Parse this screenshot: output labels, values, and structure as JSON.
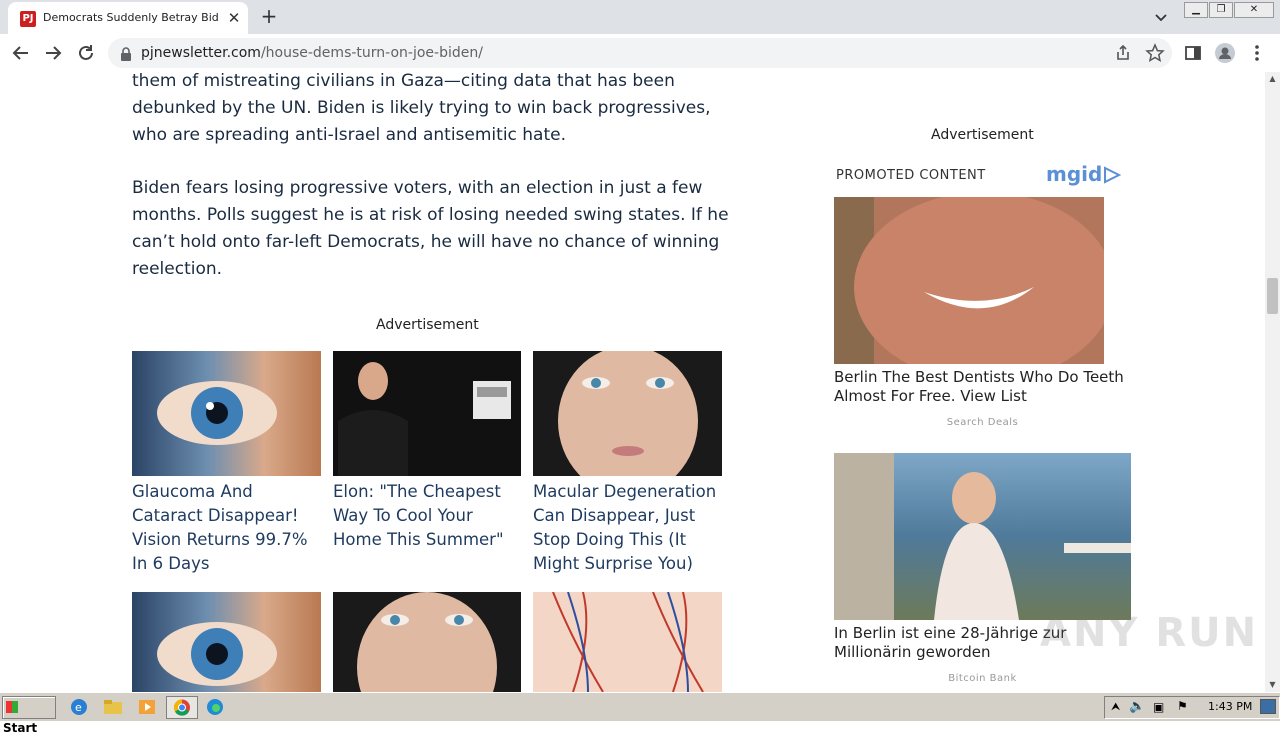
{
  "browser": {
    "tab_title": "Democrats Suddenly Betray Biden o",
    "tab_favicon_text": "PJ",
    "new_tab_label": "+",
    "url_domain": "pjnewsletter.com",
    "url_path": "/house-dems-turn-on-joe-biden/"
  },
  "article": {
    "paragraph1": "them of mistreating civilians in Gaza—citing data that has been debunked by the UN. Biden is likely trying to win back progressives, who are spreading anti-Israel and antisemitic hate.",
    "paragraph2": "Biden fears losing progressive voters, with an election in just a few months. Polls suggest he is at risk of losing needed swing states. If he can’t hold onto far-left Democrats, he will have no chance of winning reelection."
  },
  "inline_ads": {
    "label": "Advertisement",
    "cards": [
      {
        "title": "Glaucoma And Cataract Disappear! Vision Returns 99.7% In 6 Days"
      },
      {
        "title": "Elon: \"The Cheapest Way To Cool Your Home This Summer\""
      },
      {
        "title": "Macular Degeneration Can Disappear, Just Stop Doing This (It Might Surprise You)"
      }
    ]
  },
  "sidebar": {
    "ad_label": "Advertisement",
    "promoted_label": "PROMOTED CONTENT",
    "brand": "mgid",
    "items": [
      {
        "title": "Berlin The Best Dentists Who Do Teeth Almost For Free. View List",
        "source": "Search Deals"
      },
      {
        "title": "In Berlin ist eine 28-Jährige zur Millionärin geworden",
        "source": "Bitcoin Bank"
      }
    ]
  },
  "taskbar": {
    "start_label": "Start",
    "clock": "1:43 PM"
  },
  "watermark": "ANY RUN"
}
